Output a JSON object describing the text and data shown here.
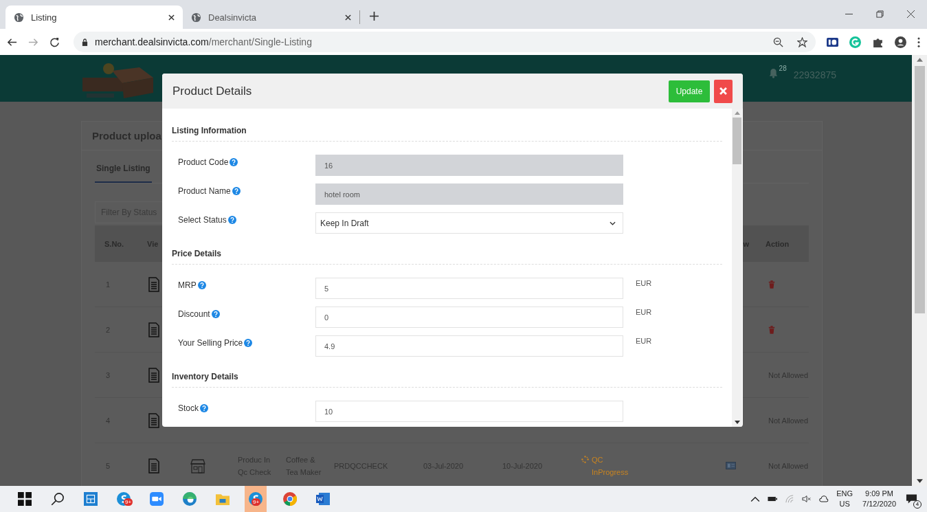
{
  "browser": {
    "tabs": [
      {
        "title": "Listing",
        "selected": true
      },
      {
        "title": "Dealsinvicta",
        "selected": false
      }
    ],
    "url_host": "merchant.dealsinvicta.com",
    "url_path": "/merchant/Single-Listing"
  },
  "site_header": {
    "notification_count": "28",
    "user_id": "22932875"
  },
  "card": {
    "title": "Product uploa",
    "tabs": [
      {
        "label": "Single Listing",
        "selected": true
      }
    ],
    "filter_placeholder": "Filter By Status",
    "table": {
      "columns": [
        "S.No.",
        "Vie",
        "",
        "",
        "",
        "",
        "",
        "",
        "",
        "w",
        "Action"
      ],
      "rows": [
        {
          "sno": "1",
          "action": {
            "kind": "delete"
          }
        },
        {
          "sno": "2",
          "action": {
            "kind": "delete"
          }
        },
        {
          "sno": "3",
          "action": {
            "kind": "text",
            "text": "Not Allowed"
          }
        },
        {
          "sno": "4",
          "action": {
            "kind": "text",
            "text": "Not Allowed"
          }
        },
        {
          "sno": "5",
          "name": "Produc In Qc Check",
          "category": "Coffee & Tea Maker",
          "code": "PRDQCCHECK",
          "created": "03-Jul-2020",
          "expiry": "10-Jul-2020",
          "status": "QC InProgress",
          "action": {
            "kind": "text",
            "text": "Not Allowed"
          }
        }
      ]
    }
  },
  "modal": {
    "title": "Product Details",
    "update_button": "Update",
    "sections": [
      {
        "title": "Listing Information",
        "fields": [
          {
            "label": "Product Code",
            "kind": "text",
            "value": "16",
            "disabled": true
          },
          {
            "label": "Product Name",
            "kind": "text",
            "value": "hotel room",
            "disabled": true
          },
          {
            "label": "Select Status",
            "kind": "select",
            "value": "Keep In Draft",
            "disabled": false
          }
        ]
      },
      {
        "title": "Price Details",
        "fields": [
          {
            "label": "MRP",
            "kind": "text",
            "value": "5",
            "disabled": false,
            "unit": "EUR"
          },
          {
            "label": "Discount",
            "kind": "text",
            "value": "0",
            "disabled": false,
            "unit": "EUR"
          },
          {
            "label": "Your Selling Price",
            "kind": "text",
            "value": "4.9",
            "disabled": false,
            "unit": "EUR"
          }
        ]
      },
      {
        "title": "Inventory Details",
        "fields": [
          {
            "label": "Stock",
            "kind": "text",
            "value": "10",
            "disabled": false
          }
        ]
      }
    ]
  },
  "taskbar": {
    "badges": [
      "9+",
      "9+"
    ],
    "language": "ENG",
    "region": "US",
    "time": "9:09 PM",
    "date": "7/12/2020",
    "notifications": "4"
  }
}
